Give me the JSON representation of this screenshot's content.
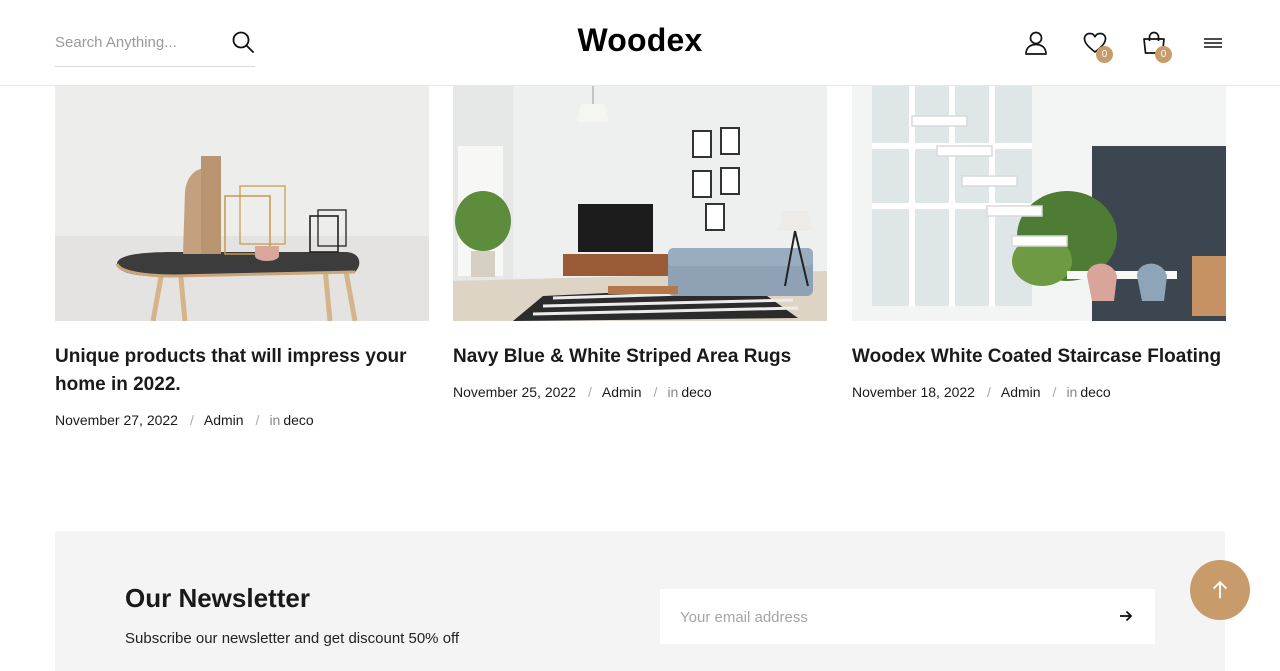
{
  "header": {
    "search": {
      "placeholder": "Search Anything..."
    },
    "logo": "Woodex",
    "wishlist_count": "0",
    "cart_count": "0",
    "icons": [
      "search-icon",
      "user-icon",
      "heart-icon",
      "cart-icon",
      "menu-icon"
    ]
  },
  "posts": [
    {
      "title": "Unique products that will impress your home in 2022.",
      "date": "November 27, 2022",
      "author": "Admin",
      "in_label": "in",
      "category": "deco"
    },
    {
      "title": "Navy Blue & White Striped Area Rugs",
      "date": "November 25, 2022",
      "author": "Admin",
      "in_label": "in",
      "category": "deco"
    },
    {
      "title": "Woodex White Coated Staircase Floating",
      "date": "November 18, 2022",
      "author": "Admin",
      "in_label": "in",
      "category": "deco"
    }
  ],
  "meta_separator": "/",
  "newsletter": {
    "title": "Our Newsletter",
    "subtitle": "Subscribe our newsletter and get discount 50% off",
    "email_placeholder": "Your email address"
  },
  "colors": {
    "accent": "#c89b6a",
    "text": "#1a1a1a",
    "newsletter_bg": "#f4f4f4"
  }
}
